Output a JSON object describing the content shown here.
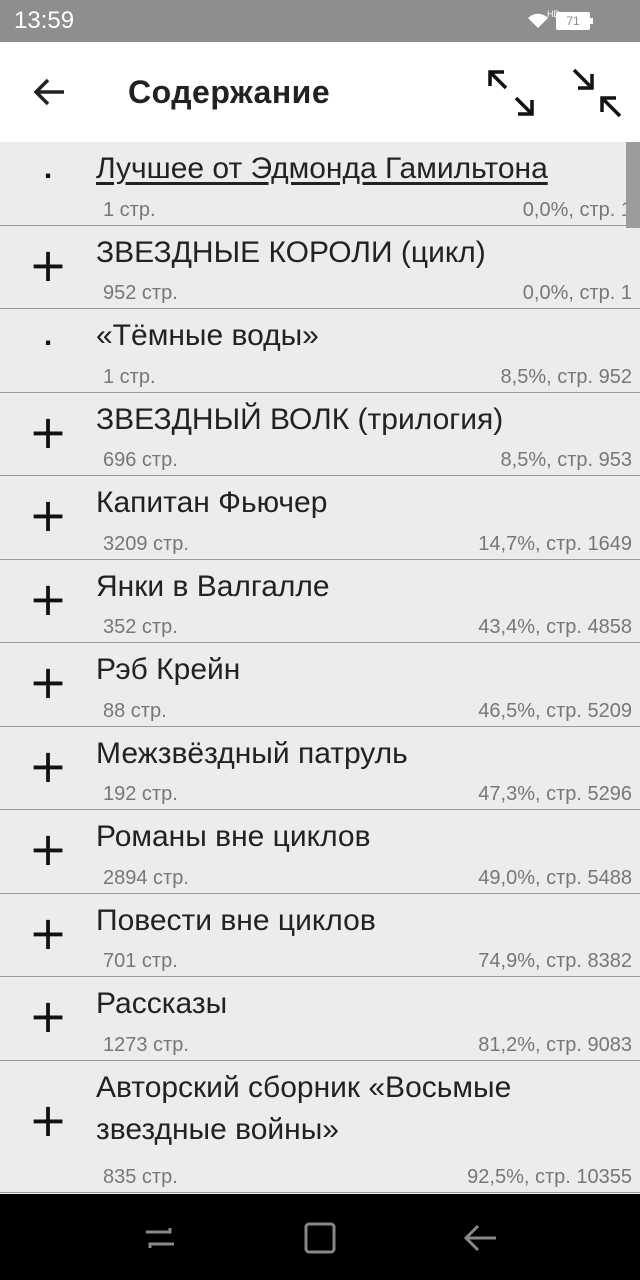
{
  "status": {
    "time": "13:59",
    "battery": "71",
    "hd": "HD"
  },
  "appbar": {
    "title": "Содержание"
  },
  "items": [
    {
      "marker": "dot",
      "title": "Лучшее от Эдмонда Гамильтона",
      "pages": "1 стр.",
      "position": "0,0%, стр. 1",
      "current": true
    },
    {
      "marker": "plus",
      "title": "ЗВЕЗДНЫЕ КОРОЛИ (цикл)",
      "pages": "952 стр.",
      "position": "0,0%, стр. 1"
    },
    {
      "marker": "dot",
      "title": "«Тёмные воды»",
      "pages": "1 стр.",
      "position": "8,5%, стр. 952"
    },
    {
      "marker": "plus",
      "title": "ЗВЕЗДНЫЙ ВОЛК (трилогия)",
      "pages": "696 стр.",
      "position": "8,5%, стр. 953"
    },
    {
      "marker": "plus",
      "title": "Капитан Фьючер",
      "pages": "3209 стр.",
      "position": "14,7%, стр. 1649"
    },
    {
      "marker": "plus",
      "title": "Янки в Валгалле",
      "pages": "352 стр.",
      "position": "43,4%, стр. 4858"
    },
    {
      "marker": "plus",
      "title": "Рэб Крейн",
      "pages": "88 стр.",
      "position": "46,5%, стр. 5209"
    },
    {
      "marker": "plus",
      "title": "Межзвёздный патруль",
      "pages": "192 стр.",
      "position": "47,3%, стр. 5296"
    },
    {
      "marker": "plus",
      "title": "Романы вне циклов",
      "pages": "2894 стр.",
      "position": "49,0%, стр. 5488"
    },
    {
      "marker": "plus",
      "title": "Повести вне циклов",
      "pages": "701 стр.",
      "position": "74,9%, стр. 8382"
    },
    {
      "marker": "plus",
      "title": "Рассказы",
      "pages": "1273 стр.",
      "position": "81,2%, стр. 9083"
    },
    {
      "marker": "plus",
      "title": "Авторский сборник «Восьмые звездные войны»",
      "pages": "835 стр.",
      "position": "92,5%, стр. 10355"
    }
  ],
  "icons": {
    "back": "arrow-left-icon",
    "expand": "expand-all-icon",
    "collapse": "collapse-all-icon",
    "nav": [
      "recent-apps-icon",
      "home-icon",
      "nav-back-icon"
    ]
  },
  "colors": {
    "statusbar": "#8e8e8e",
    "appbar": "#ffffff",
    "list_bg": "#ececec",
    "navbar": "#000000"
  }
}
